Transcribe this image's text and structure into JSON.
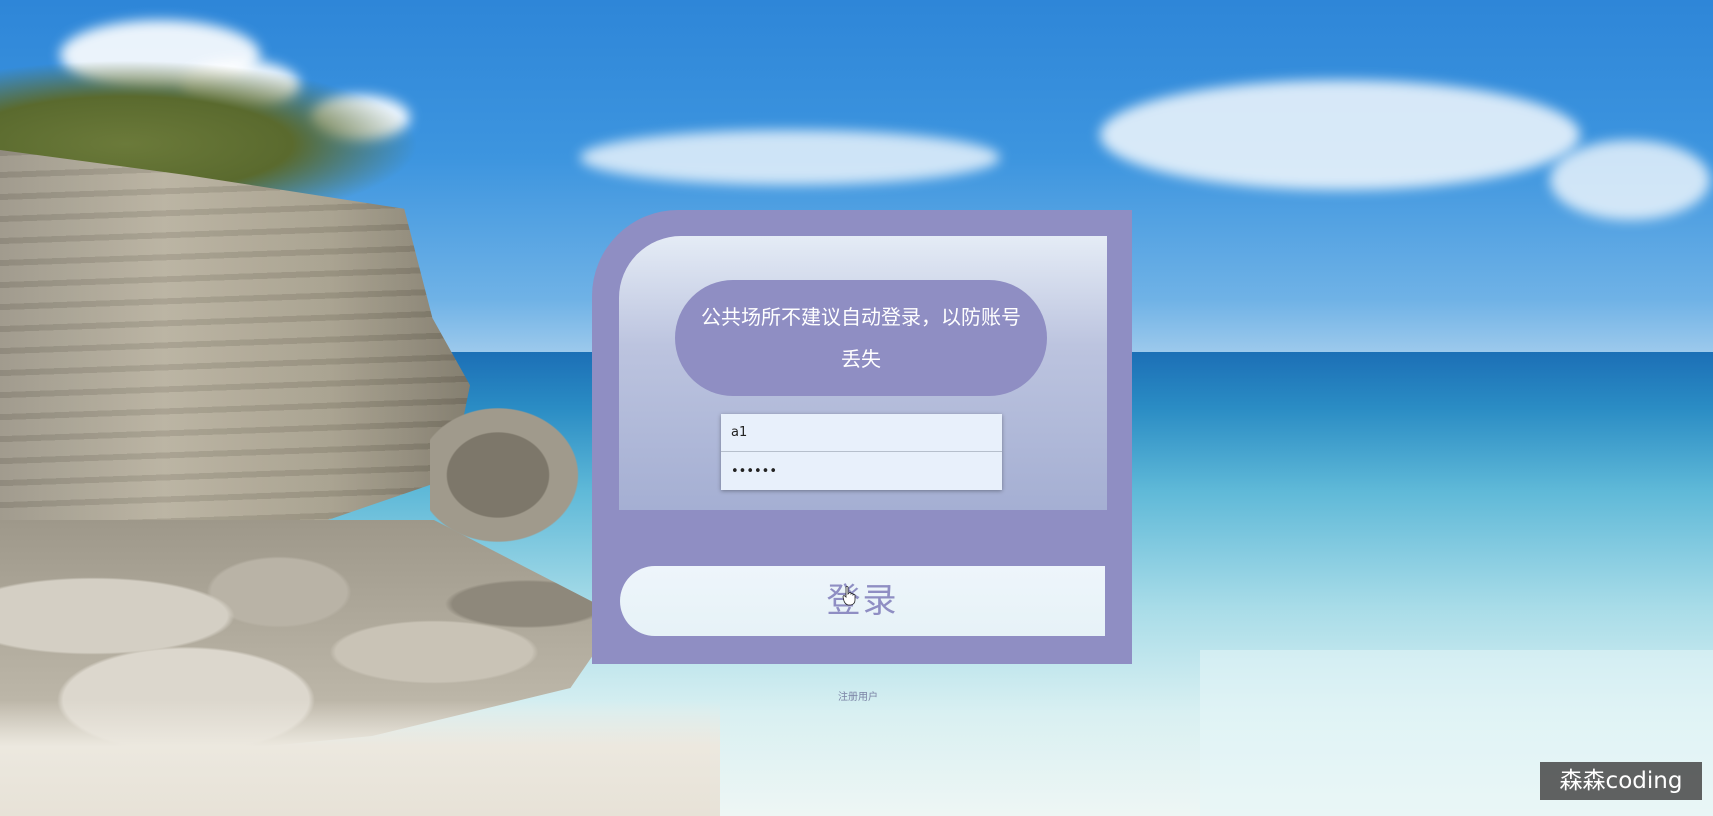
{
  "login": {
    "notice": "公共场所不建议自动登录，以防账号丢失",
    "username_value": "a1",
    "password_value": "••••••",
    "login_button_label": "登录",
    "register_link_label": "注册用户"
  },
  "watermark": {
    "text": "森森coding"
  },
  "colors": {
    "card_accent": "#8f8ec3",
    "input_background": "#e8f0fb"
  }
}
